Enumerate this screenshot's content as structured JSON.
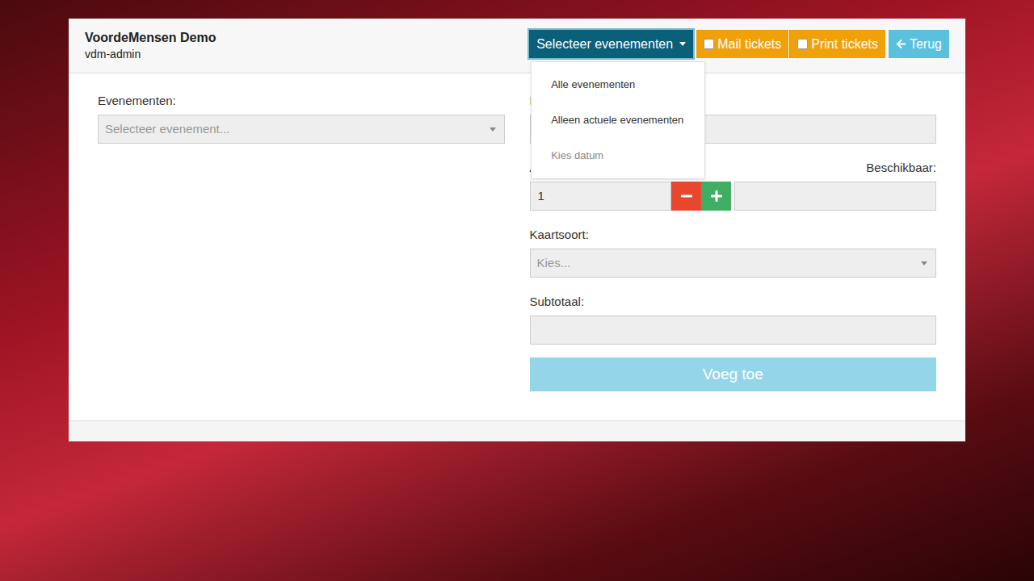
{
  "header": {
    "title": "VoordeMensen Demo",
    "subtitle": "vdm-admin"
  },
  "toolbar": {
    "events_button": {
      "label": "Selecteer evenementen",
      "expanded": true
    },
    "mail_tickets": {
      "label": "Mail tickets",
      "checked": false
    },
    "print_tickets": {
      "label": "Print tickets",
      "checked": false
    },
    "back_button": {
      "label": "Terug"
    }
  },
  "menu": {
    "items": [
      {
        "label": "Alle evenementen",
        "disabled": false
      },
      {
        "label": "Alleen actuele evenementen",
        "disabled": false
      },
      {
        "label": "Kies datum",
        "disabled": true
      }
    ]
  },
  "form": {
    "events": {
      "label": "Evenementen:",
      "placeholder": "Selecteer evenement..."
    },
    "price": {
      "label": "Prij",
      "value": ""
    },
    "quantity": {
      "label": "Aan",
      "value": "1"
    },
    "available": {
      "label": "Beschikbaar:",
      "value": ""
    },
    "ticket_type": {
      "label": "Kaartsoort:",
      "placeholder": "Kies..."
    },
    "subtotal": {
      "label": "Subtotaal:",
      "value": ""
    },
    "add_button": {
      "label": "Voeg toe",
      "disabled": true
    }
  }
}
